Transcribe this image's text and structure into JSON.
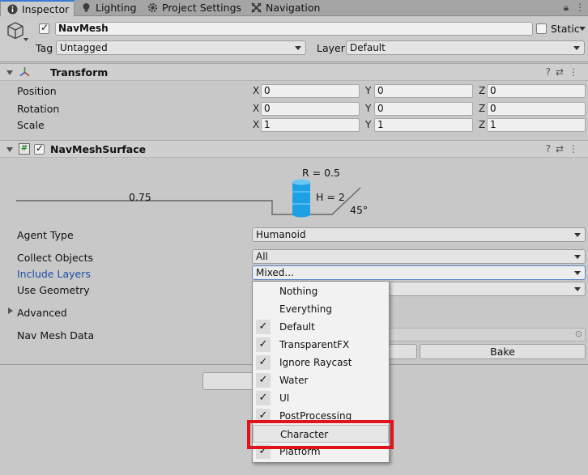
{
  "tabs": [
    {
      "label": "Inspector",
      "icon": "info-icon"
    },
    {
      "label": "Lighting",
      "icon": "bulb-icon"
    },
    {
      "label": "Project Settings",
      "icon": "gear-icon"
    },
    {
      "label": "Navigation",
      "icon": "navigation-icon"
    }
  ],
  "header": {
    "name": "NavMesh",
    "static_label": "Static",
    "tag_label": "Tag",
    "tag_value": "Untagged",
    "layer_label": "Layer",
    "layer_value": "Default"
  },
  "transform": {
    "title": "Transform",
    "rows": [
      {
        "label": "Position",
        "x": "0",
        "y": "0",
        "z": "0"
      },
      {
        "label": "Rotation",
        "x": "0",
        "y": "0",
        "z": "0"
      },
      {
        "label": "Scale",
        "x": "1",
        "y": "1",
        "z": "1"
      }
    ],
    "axes": [
      "X",
      "Y",
      "Z"
    ]
  },
  "navmesh_surface": {
    "title": "NavMeshSurface",
    "diagram": {
      "radius": "R = 0.5",
      "height": "H = 2",
      "step": "0.75",
      "slope": "45°"
    },
    "agent_type_label": "Agent Type",
    "agent_type_value": "Humanoid",
    "collect_objects_label": "Collect Objects",
    "collect_objects_value": "All",
    "include_layers_label": "Include Layers",
    "include_layers_value": "Mixed...",
    "use_geometry_label": "Use Geometry",
    "advanced_label": "Advanced",
    "nav_mesh_data_label": "Nav Mesh Data",
    "bake_label": "Bake"
  },
  "layers_menu": [
    {
      "label": "Nothing",
      "checked": false
    },
    {
      "label": "Everything",
      "checked": false
    },
    {
      "label": "Default",
      "checked": true
    },
    {
      "label": "TransparentFX",
      "checked": true
    },
    {
      "label": "Ignore Raycast",
      "checked": true
    },
    {
      "label": "Water",
      "checked": true
    },
    {
      "label": "UI",
      "checked": true
    },
    {
      "label": "PostProcessing",
      "checked": true
    },
    {
      "label": "Character",
      "checked": false
    },
    {
      "label": "Platform",
      "checked": true
    }
  ],
  "colors": {
    "accent": "#3a7bd5",
    "highlight_box": "#e0121a",
    "agent_cylinder": "#1ea0e6"
  }
}
